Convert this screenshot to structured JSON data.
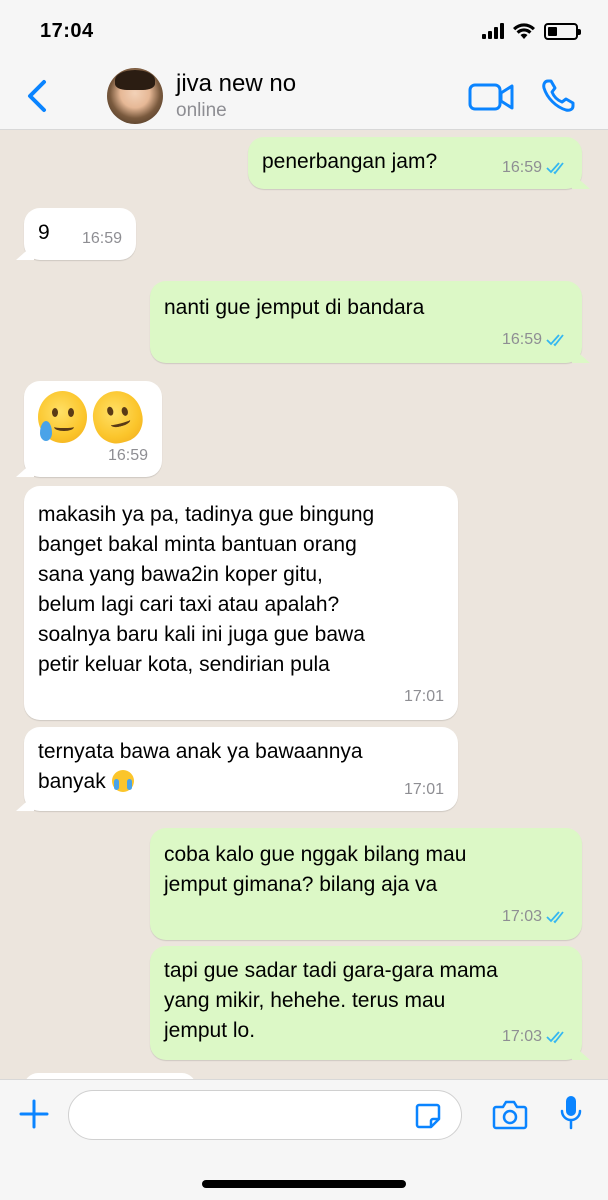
{
  "status_bar": {
    "time": "17:04"
  },
  "header": {
    "name": "jiva new no",
    "status": "online"
  },
  "messages": [
    {
      "dir": "out",
      "text": "penerbangan jam?",
      "time": "16:59"
    },
    {
      "dir": "in",
      "text": "9",
      "time": "16:59"
    },
    {
      "dir": "out",
      "text": "nanti gue jemput di bandara",
      "time": "16:59"
    },
    {
      "dir": "in",
      "type": "emoji",
      "emojis": [
        "face-holding-back-tears",
        "melting-face"
      ],
      "time": "16:59"
    },
    {
      "dir": "in",
      "text": "makasih ya pa, tadinya gue bingung\nbanget bakal minta bantuan orang\nsana yang bawa2in koper gitu,\nbelum lagi cari taxi atau apalah?\nsoalnya baru kali ini juga gue bawa\npetir keluar kota, sendirian pula",
      "time": "17:01"
    },
    {
      "dir": "in",
      "text": "ternyata bawa anak ya bawaannya\nbanyak",
      "emoji": "loudly-crying-face",
      "time": "17:01"
    },
    {
      "dir": "out",
      "text": "coba kalo gue nggak bilang mau\njemput gimana? bilang aja va",
      "time": "17:03"
    },
    {
      "dir": "out",
      "text": "tapi gue sadar tadi gara-gara mama\nyang mikir, hehehe. terus mau\njemput lo.",
      "time": "17:03"
    }
  ],
  "input": {
    "value": "",
    "placeholder": ""
  },
  "colors": {
    "accent": "#0a84ff",
    "outgoing": "#dcf8c6",
    "incoming": "#ffffff",
    "tick": "#34b7f1"
  }
}
